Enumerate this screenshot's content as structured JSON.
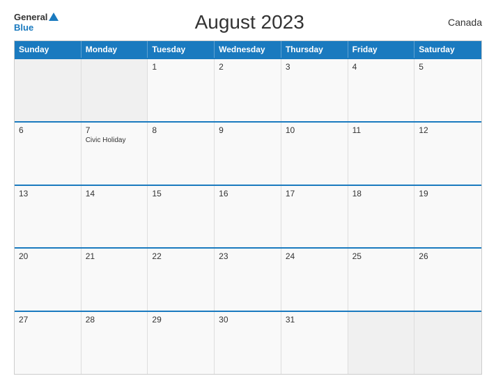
{
  "header": {
    "logo": {
      "general": "General",
      "blue": "Blue",
      "triangle": true
    },
    "title": "August 2023",
    "country": "Canada"
  },
  "calendar": {
    "day_headers": [
      "Sunday",
      "Monday",
      "Tuesday",
      "Wednesday",
      "Thursday",
      "Friday",
      "Saturday"
    ],
    "weeks": [
      [
        {
          "date": "",
          "event": ""
        },
        {
          "date": "",
          "event": ""
        },
        {
          "date": "1",
          "event": ""
        },
        {
          "date": "2",
          "event": ""
        },
        {
          "date": "3",
          "event": ""
        },
        {
          "date": "4",
          "event": ""
        },
        {
          "date": "5",
          "event": ""
        }
      ],
      [
        {
          "date": "6",
          "event": ""
        },
        {
          "date": "7",
          "event": "Civic Holiday"
        },
        {
          "date": "8",
          "event": ""
        },
        {
          "date": "9",
          "event": ""
        },
        {
          "date": "10",
          "event": ""
        },
        {
          "date": "11",
          "event": ""
        },
        {
          "date": "12",
          "event": ""
        }
      ],
      [
        {
          "date": "13",
          "event": ""
        },
        {
          "date": "14",
          "event": ""
        },
        {
          "date": "15",
          "event": ""
        },
        {
          "date": "16",
          "event": ""
        },
        {
          "date": "17",
          "event": ""
        },
        {
          "date": "18",
          "event": ""
        },
        {
          "date": "19",
          "event": ""
        }
      ],
      [
        {
          "date": "20",
          "event": ""
        },
        {
          "date": "21",
          "event": ""
        },
        {
          "date": "22",
          "event": ""
        },
        {
          "date": "23",
          "event": ""
        },
        {
          "date": "24",
          "event": ""
        },
        {
          "date": "25",
          "event": ""
        },
        {
          "date": "26",
          "event": ""
        }
      ],
      [
        {
          "date": "27",
          "event": ""
        },
        {
          "date": "28",
          "event": ""
        },
        {
          "date": "29",
          "event": ""
        },
        {
          "date": "30",
          "event": ""
        },
        {
          "date": "31",
          "event": ""
        },
        {
          "date": "",
          "event": ""
        },
        {
          "date": "",
          "event": ""
        }
      ]
    ]
  }
}
